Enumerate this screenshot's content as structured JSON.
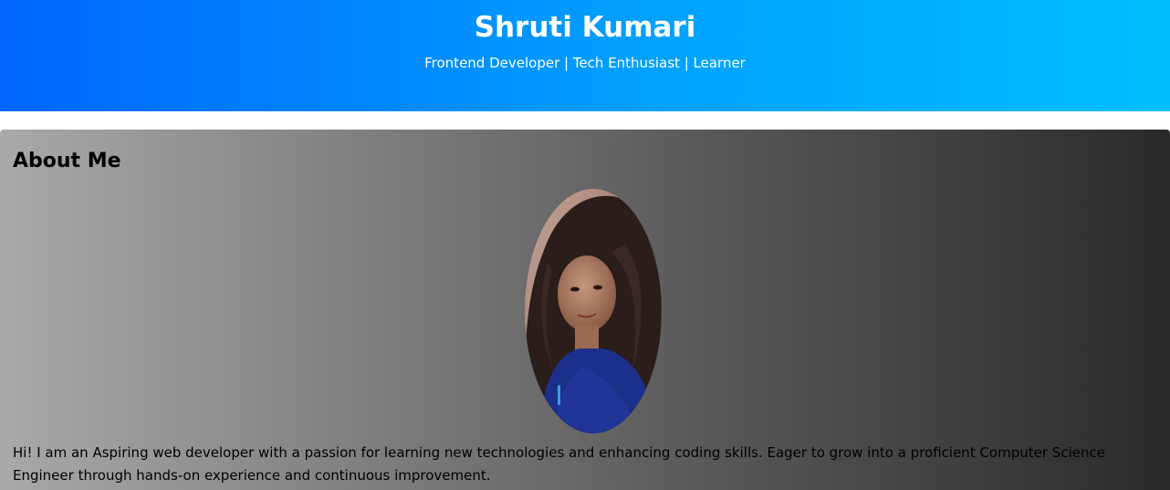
{
  "header": {
    "name": "Shruti Kumari",
    "tagline": "Frontend Developer | Tech Enthusiast | Learner"
  },
  "about": {
    "heading": "About Me",
    "bio_line1": "Hi! I am an Aspiring web developer with a passion for learning new technologies and enhancing coding skills. Eager to grow into a proficient Computer Science",
    "bio_line2": "Engineer through hands-on experience and continuous improvement."
  },
  "colors": {
    "header_gradient_start": "#0066ff",
    "header_gradient_end": "#00bfff",
    "about_gradient_start": "#a9a9a9",
    "about_gradient_end": "#2a2a2a"
  }
}
